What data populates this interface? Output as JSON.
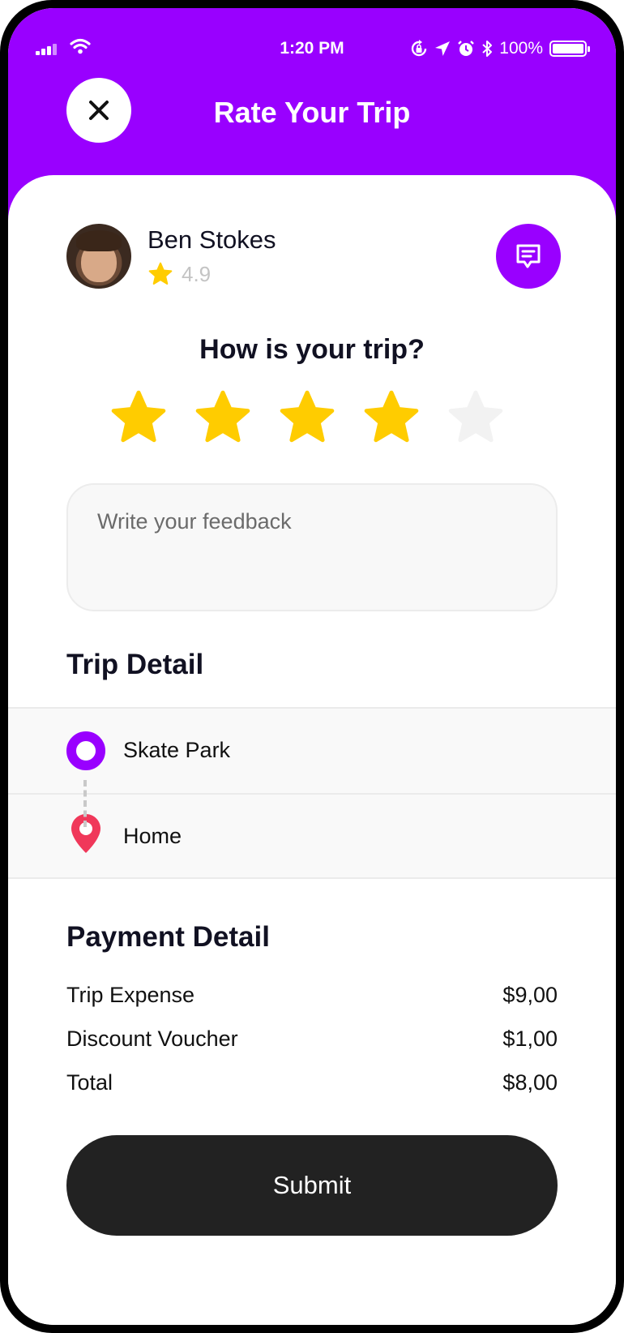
{
  "status_bar": {
    "time": "1:20 PM",
    "battery": "100%",
    "icons": [
      "signal-icon",
      "wifi-icon",
      "rotation-lock-icon",
      "location-arrow-icon",
      "alarm-icon",
      "bluetooth-icon",
      "battery-icon"
    ]
  },
  "header": {
    "title": "Rate Your Trip",
    "close_icon": "close-icon",
    "background": "#9900ff"
  },
  "driver": {
    "name": "Ben Stokes",
    "rating": "4.9",
    "chat_icon": "chat-icon"
  },
  "rating": {
    "question": "How is your trip?",
    "stars_total": 5,
    "stars_selected": 4,
    "active_color": "#ffcc00",
    "inactive_color": "#f2f2f2"
  },
  "feedback": {
    "placeholder": "Write your feedback",
    "value": ""
  },
  "trip": {
    "title": "Trip Detail",
    "from": "Skate Park",
    "to": "Home"
  },
  "payment": {
    "title": "Payment Detail",
    "rows": [
      {
        "label": "Trip Expense",
        "amount": "$9,00"
      },
      {
        "label": "Discount Voucher",
        "amount": "$1,00"
      },
      {
        "label": "Total",
        "amount": "$8,00"
      }
    ]
  },
  "submit_label": "Submit",
  "colors": {
    "accent": "#9900ff",
    "star": "#ffcc00",
    "pin": "#f0385a",
    "button": "#222222"
  }
}
